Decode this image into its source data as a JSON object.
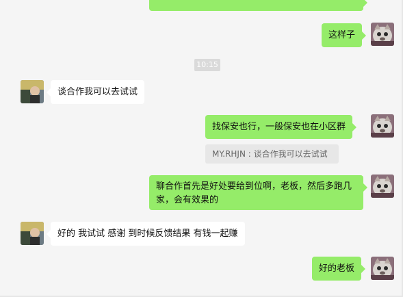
{
  "chat": {
    "timestamp": "10:15",
    "messages": [
      {
        "from": "me",
        "text": ""
      },
      {
        "from": "me",
        "text": "这样子"
      },
      {
        "from": "other",
        "text": "谈合作我可以去试试"
      },
      {
        "from": "me",
        "text": "找保安也行，一般保安也在小区群"
      },
      {
        "quote": "MY.RHJN : 谈合作我可以去试试"
      },
      {
        "from": "me",
        "text": "聊合作首先是好处要给到位啊，老板，然后多跑几家，会有效果的"
      },
      {
        "from": "other",
        "text": "好的 我试试 感谢 到时候反馈结果 有钱一起赚"
      },
      {
        "from": "me",
        "text": "好的老板"
      }
    ]
  },
  "colors": {
    "background": "#f5f5f5",
    "my_bubble": "#95ec69",
    "other_bubble": "#ffffff",
    "timestamp_bg": "#dadada",
    "quote_bg": "#e7e7e7"
  },
  "icons": {
    "my_avatar": "cat-avatar-icon",
    "other_avatar": "person-avatar-icon"
  }
}
